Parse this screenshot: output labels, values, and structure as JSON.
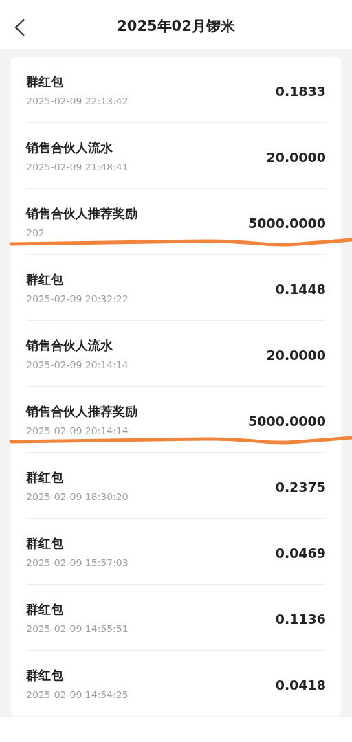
{
  "header": {
    "title": "2025年02月锣米"
  },
  "records": [
    {
      "title": "群红包",
      "time": "2025-02-09 22:13:42",
      "amount": "0.1833",
      "scribbled": false
    },
    {
      "title": "销售合伙人流水",
      "time": "2025-02-09 21:48:41",
      "amount": "20.0000",
      "scribbled": false
    },
    {
      "title": "销售合伙人推荐奖励",
      "time": "202",
      "amount": "5000.0000",
      "scribbled": true
    },
    {
      "title": "群红包",
      "time": "2025-02-09 20:32:22",
      "amount": "0.1448",
      "scribbled": false
    },
    {
      "title": "销售合伙人流水",
      "time": "2025-02-09 20:14:14",
      "amount": "20.0000",
      "scribbled": false
    },
    {
      "title": "销售合伙人推荐奖励",
      "time": "2025-02-09 20:14:14",
      "amount": "5000.0000",
      "scribbled": true
    },
    {
      "title": "群红包",
      "time": "2025-02-09 18:30:20",
      "amount": "0.2375",
      "scribbled": false
    },
    {
      "title": "群红包",
      "time": "2025-02-09 15:57:03",
      "amount": "0.0469",
      "scribbled": false
    },
    {
      "title": "群红包",
      "time": "2025-02-09 14:55:51",
      "amount": "0.1136",
      "scribbled": false
    },
    {
      "title": "群红包",
      "time": "2025-02-09 14:54:25",
      "amount": "0.0418",
      "scribbled": false
    }
  ]
}
